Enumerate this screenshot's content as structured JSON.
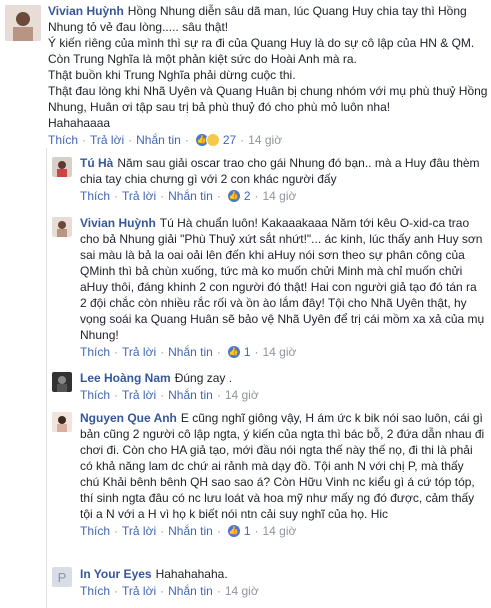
{
  "comments": [
    {
      "name": "Vivian Huỳnh",
      "text": "Hồng Nhung diễn sâu dã man, lúc Quang Huy chia tay thì Hồng Nhung tỏ vẻ đau lòng..... sâu thật!",
      "paragraphs": [
        "Ý kiến riêng của mình thì sự ra đi của Quang Huy là do sự cô lập của HN & QM. Còn Trung Nghĩa là một phản kiệt sức do Hoài Anh mà ra.",
        "Thật buồn khi Trung Nghĩa phải dừng cuộc thi.",
        "Thật đau lòng khi Nhã Uyên và Quang Huân bị chung nhóm với mụ phù thuỷ Hồng Nhung, Huân ơi tập sau trị bả phù thuỷ đó cho phù mỏ luôn nha!",
        "Hahahaaaa"
      ],
      "actions": {
        "like": "Thích",
        "reply": "Trả lời",
        "message": "Nhắn tin"
      },
      "reactions": {
        "types": [
          "like-icon",
          "haha-icon"
        ],
        "count": "27"
      },
      "time": "14 giờ"
    },
    {
      "name": "Tú Hà",
      "text": "Năm sau giải oscar trao cho gái Nhung đó bạn.. mà a Huy đâu thèm chia tay chia chưng gì với 2 con khác người đấy",
      "actions": {
        "like": "Thích",
        "reply": "Trả lời",
        "message": "Nhắn tin"
      },
      "reactions": {
        "types": [
          "like-icon"
        ],
        "count": "2"
      },
      "time": "14 giờ"
    },
    {
      "name": "Vivian Huỳnh",
      "text": "Tú Hà chuẩn luôn! Kakaaakaaa Năm tới kêu O-xid-ca trao cho bả Nhung giải \"Phù Thuỷ xứt sắt nhứt!\"... ác kinh, lúc thấy anh Huy sơn sai màu là bả la oai oải lên đến khi aHuy nói sơn theo sự phân công của QMinh thì bả chùn xuống, tức mà ko muốn chửi Minh mà chỉ muốn chửi aHuy thôi, đáng khinh 2 con người đó thật! Hai con người giả tạo đó tán ra 2 đội chắc còn nhiều rắc rối và ồn ào lắm đây! Tội cho Nhã Uyên thật, hy vọng soái ka Quang Huân sẽ bảo vệ Nhã Uyên để trị cái mồm xa xả của mụ Nhung!",
      "actions": {
        "like": "Thích",
        "reply": "Trả lời",
        "message": "Nhắn tin"
      },
      "reactions": {
        "types": [
          "like-icon"
        ],
        "count": "1"
      },
      "time": "14 giờ"
    },
    {
      "name": "Lee Hoàng Nam",
      "text": "Đúng zay .",
      "actions": {
        "like": "Thích",
        "reply": "Trả lời",
        "message": "Nhắn tin"
      },
      "reactions": {
        "types": [],
        "count": ""
      },
      "time": "14 giờ"
    },
    {
      "name": "Nguyen Que Anh",
      "text": "E cũng nghĩ giông vậy, H ám ức k bik nói sao luôn, cái gì bản cũng 2 người cô lập ngta, ý kiến của ngta thì bác bỗ, 2 đứa dẫn nhau đi chơi đi. Còn cho HA giả tạo, mới đầu nói ngta thế này thế nọ, đi thi là phải có khả năng lam dc chứ ai rảnh mà dạy đồ. Tội anh N với chị P, mà thấy chú Khải bênh bênh QH sao sao á? Còn Hữu Vinh nc kiểu gì á cứ tóp tóp, thí sinh ngta đâu có nc lưu loát và hoa mỹ như mấy ng đó được, cảm thấy tội a N với a H vì họ k biết nói ntn cải suy nghĩ của họ. Hic",
      "actions": {
        "like": "Thích",
        "reply": "Trả lời",
        "message": "Nhắn tin"
      },
      "reactions": {
        "types": [
          "like-icon"
        ],
        "count": "1"
      },
      "time": "14 giờ"
    },
    {
      "name": "In Your Eyes",
      "text": "Hahahahaha.",
      "actions": {
        "like": "Thích",
        "reply": "Trả lời",
        "message": "Nhắn tin"
      },
      "reactions": {
        "types": [],
        "count": ""
      },
      "time": "14 giờ"
    }
  ]
}
